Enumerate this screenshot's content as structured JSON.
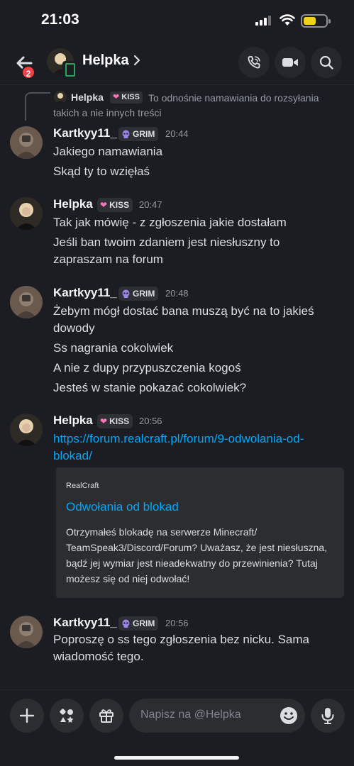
{
  "status_bar": {
    "time": "21:03",
    "battery_level": 0.55
  },
  "header": {
    "back_badge": "2",
    "title": "Helpka",
    "icons": [
      "back-arrow-icon",
      "phone-call-icon",
      "video-camera-icon",
      "search-icon"
    ]
  },
  "reply": {
    "username": "Helpka",
    "tag": "KISS",
    "text": "To odnośnie namawiania do rozsyłania takich a nie innych treści"
  },
  "messages": [
    {
      "username": "Kartkyy11_",
      "tag": "GRIM",
      "time": "20:44",
      "lines": [
        "Jakiego namawiania",
        "Skąd ty to wzięłaś"
      ]
    },
    {
      "username": "Helpka",
      "tag": "KISS",
      "time": "20:47",
      "lines": [
        "Tak jak mówię - z zgłoszenia jakie dostałam",
        "Jeśli ban twoim zdaniem jest niesłuszny to",
        "zapraszam na forum"
      ]
    },
    {
      "username": "Kartkyy11_",
      "tag": "GRIM",
      "time": "20:48",
      "lines": [
        "Żebym mógł dostać bana muszą być na to jakieś",
        "dowody",
        "Ss nagrania cokolwiek",
        "A nie z dupy przypuszczenia kogoś",
        "Jesteś w stanie pokazać cokolwiek?"
      ]
    },
    {
      "username": "Helpka",
      "tag": "KISS",
      "time": "20:56",
      "lines": [
        "https://forum.realcraft.pl/forum/9-odwolania-od-",
        "blokad/"
      ]
    },
    {
      "username": "Kartkyy11_",
      "tag": "GRIM",
      "time": "20:56",
      "lines": [
        "Poproszę o ss tego zgłoszenia bez nicku. Sama",
        "wiadomość tego."
      ]
    }
  ],
  "embed": {
    "provider": "RealCraft",
    "title": "Odwołania od blokad",
    "description": "Otrzymałeś blokadę na serwerze Minecraft/ TeamSpeak3/Discord/Forum? Uważasz, że jest niesłuszna, bądź jej wymiar jest nieadekwatny do przewinienia? Tutaj możesz się od niej odwołać!"
  },
  "composer": {
    "placeholder": "Napisz na @Helpka",
    "icons": [
      "plus-icon",
      "apps-icon",
      "gift-icon",
      "emoji-icon",
      "microphone-icon"
    ]
  },
  "colors": {
    "link": "#00a8fc",
    "background": "#1c1d22",
    "badge": "#f23f43"
  }
}
